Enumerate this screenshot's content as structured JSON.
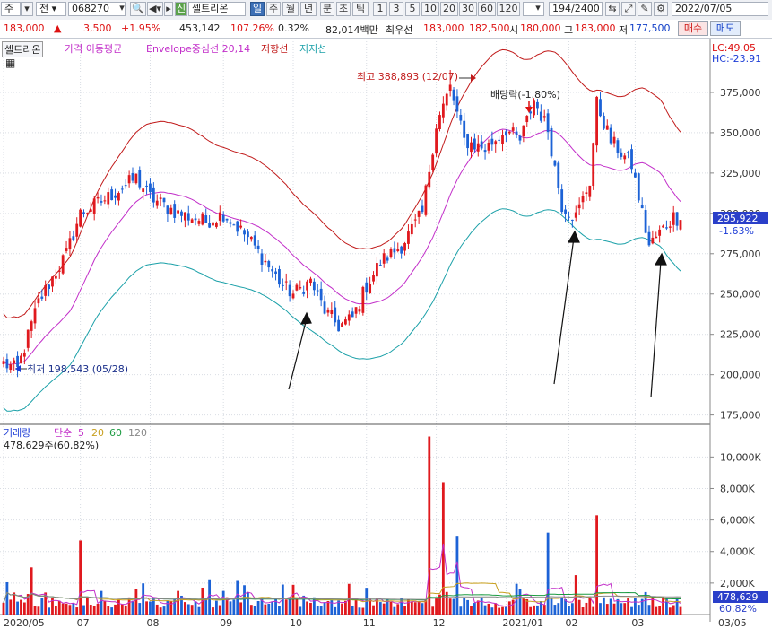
{
  "toolbar": {
    "market": "주",
    "kind": "전",
    "code": "068270",
    "badge": "신",
    "name": "셀트리온",
    "periods": [
      "일",
      "주",
      "월",
      "년",
      "분",
      "초",
      "틱"
    ],
    "intervals": [
      "1",
      "3",
      "5",
      "10",
      "20",
      "30",
      "60",
      "120"
    ],
    "count": "194",
    "total": "2400",
    "date": "2022/07/05"
  },
  "quote": {
    "price": "183,000",
    "change": "3,500",
    "change_pct": "+1.95%",
    "volume": "453,142",
    "vol_ratio": "107.26%",
    "turnover": "0.32%",
    "amount": "82,014백만",
    "sell_label": "최우선",
    "best_ask": "183,000",
    "best_bid": "182,500",
    "open_label": "시",
    "open": "180,000",
    "high_label": "고",
    "high": "183,000",
    "low_label": "저",
    "low": "177,500",
    "buy_btn": "매수",
    "sell_btn": "매도"
  },
  "legend": {
    "stock": "셀트리온",
    "ma": "가격 이동평균",
    "env": "Envelope중심선 20,14",
    "res": "저항선",
    "sup": "지지선"
  },
  "volume_legend": {
    "title": "거래량",
    "ma": "단순",
    "p1": "5",
    "p2": "20",
    "p3": "60",
    "p4": "120",
    "current": "478,629주(60,82%)"
  },
  "right_top": {
    "lc": "LC:49.05",
    "hc": "HC:-23.91"
  },
  "annotations": {
    "high": "최고 388,893 (12/07)",
    "low": "최저 198,543 (05/28)",
    "dividend": "배당락(-1.80%)",
    "last_price": "295,922",
    "last_pct": "-1.63%",
    "last_volume": "478,629",
    "last_volume_pct": "60.82%"
  },
  "colors": {
    "up": "#e0191e",
    "down": "#1c62d6",
    "resistance": "#c11a1a",
    "support": "#1aa0a8",
    "center": "#c22ec9",
    "price_box": "#2a3fc9"
  },
  "chart_data": {
    "type": "candlestick",
    "price_axis": {
      "ticks": [
        "175,000",
        "200,000",
        "225,000",
        "250,000",
        "275,000",
        "300,000",
        "325,000",
        "350,000",
        "375,000"
      ],
      "ylim": [
        172000,
        395000
      ]
    },
    "volume_axis": {
      "ticks": [
        "2,000K",
        "4,000K",
        "6,000K",
        "8,000K",
        "10,000K"
      ],
      "ylim": [
        0,
        11500
      ]
    },
    "x_ticks": [
      "2020/05",
      "07",
      "08",
      "09",
      "10",
      "11",
      "12",
      "2021/01",
      "02",
      "03",
      "03/05"
    ],
    "x_tick_bars": [
      0,
      22,
      42,
      63,
      83,
      104,
      124,
      144,
      162,
      181,
      194
    ],
    "trend_close": [
      [
        0,
        207
      ],
      [
        4,
        203
      ],
      [
        10,
        245
      ],
      [
        18,
        275
      ],
      [
        22,
        300
      ],
      [
        30,
        310
      ],
      [
        38,
        322
      ],
      [
        42,
        310
      ],
      [
        50,
        300
      ],
      [
        58,
        295
      ],
      [
        63,
        300
      ],
      [
        70,
        285
      ],
      [
        75,
        270
      ],
      [
        80,
        255
      ],
      [
        83,
        250
      ],
      [
        88,
        258
      ],
      [
        92,
        240
      ],
      [
        96,
        230
      ],
      [
        100,
        235
      ],
      [
        104,
        255
      ],
      [
        108,
        270
      ],
      [
        114,
        280
      ],
      [
        120,
        300
      ],
      [
        124,
        355
      ],
      [
        128,
        378
      ],
      [
        132,
        345
      ],
      [
        138,
        340
      ],
      [
        144,
        352
      ],
      [
        148,
        345
      ],
      [
        152,
        370
      ],
      [
        156,
        352
      ],
      [
        160,
        305
      ],
      [
        164,
        298
      ],
      [
        168,
        320
      ],
      [
        170,
        368
      ],
      [
        174,
        345
      ],
      [
        180,
        330
      ],
      [
        185,
        280
      ],
      [
        188,
        288
      ],
      [
        192,
        298
      ],
      [
        194,
        296
      ]
    ],
    "high_point": {
      "bar": 128,
      "value": 388893,
      "label": "최고 388,893 (12/07)"
    },
    "low_point": {
      "bar": 4,
      "value": 198543,
      "label": "최저 198,543 (05/28)"
    },
    "volume_spikes": [
      [
        3,
        1400
      ],
      [
        8,
        3000
      ],
      [
        12,
        1400
      ],
      [
        22,
        4700
      ],
      [
        28,
        1500
      ],
      [
        38,
        1600
      ],
      [
        50,
        1500
      ],
      [
        63,
        1500
      ],
      [
        70,
        1400
      ],
      [
        86,
        1200
      ],
      [
        104,
        1700
      ],
      [
        122,
        11300
      ],
      [
        126,
        8400
      ],
      [
        130,
        5000
      ],
      [
        148,
        1600
      ],
      [
        156,
        5200
      ],
      [
        164,
        2500
      ],
      [
        170,
        6300
      ],
      [
        174,
        1000
      ],
      [
        186,
        1100
      ],
      [
        194,
        478
      ]
    ],
    "volume_base": 700,
    "envelope_pct": 14,
    "envelope_period": 20,
    "last_close": 295922,
    "last_volume": 478629
  }
}
